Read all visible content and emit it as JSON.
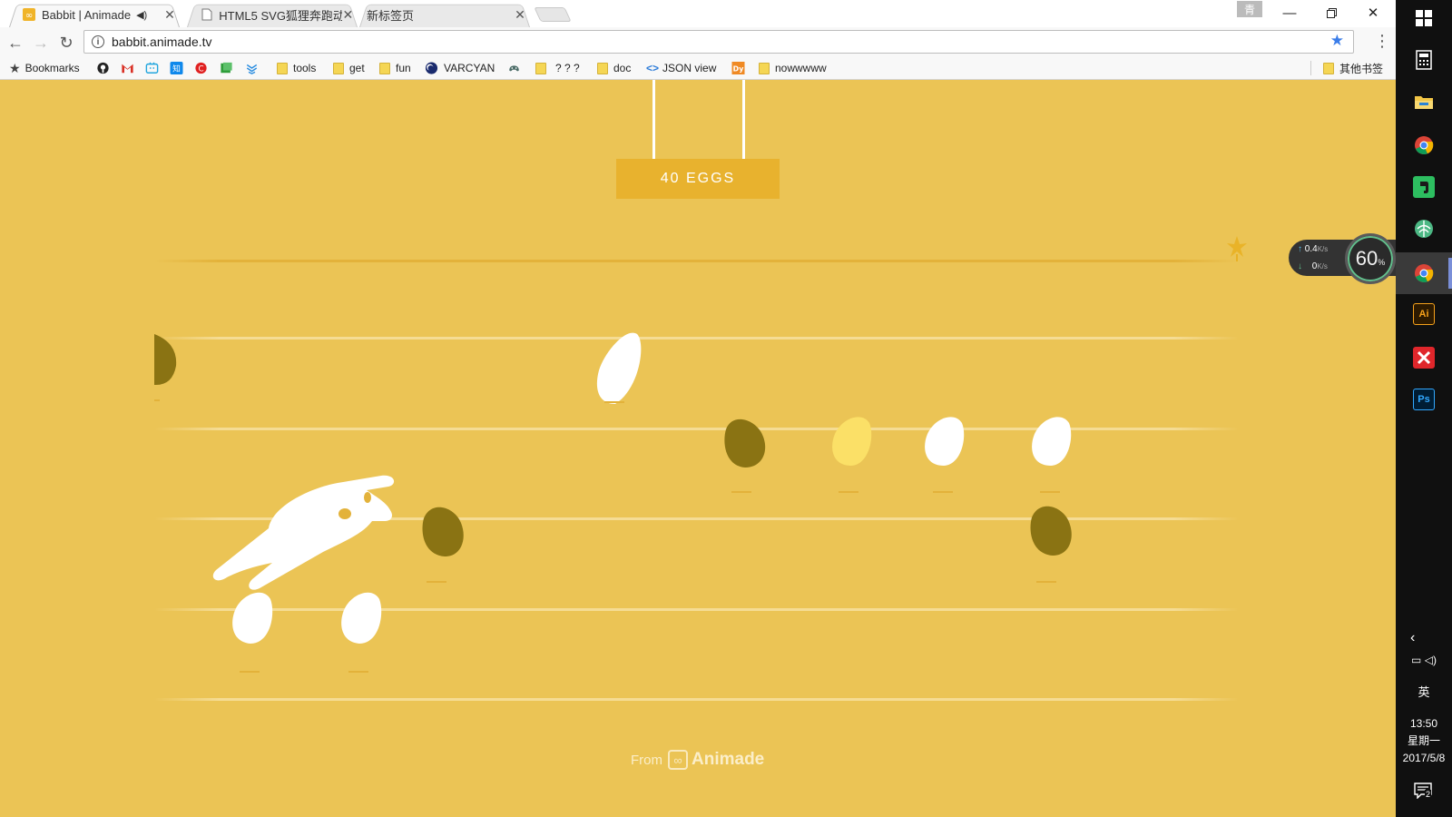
{
  "tabs": [
    {
      "title": "Babbit | Animade",
      "favicon": "animade-icon",
      "active": true
    },
    {
      "title": "HTML5 SVG狐狸奔跑动",
      "favicon": "page-icon",
      "active": false
    },
    {
      "title": "新标签页",
      "favicon": "",
      "active": false
    }
  ],
  "window": {
    "profile_badge": "青"
  },
  "address_bar": {
    "url": "babbit.animade.tv"
  },
  "bookmarks": {
    "items": [
      {
        "label": "Bookmarks",
        "icon": "star-icon"
      },
      {
        "label": "",
        "icon": "github-icon"
      },
      {
        "label": "",
        "icon": "gmail-icon"
      },
      {
        "label": "",
        "icon": "bilibili-icon"
      },
      {
        "label": "",
        "icon": "zhihu-icon"
      },
      {
        "label": "",
        "icon": "red-app-icon"
      },
      {
        "label": "",
        "icon": "green-app-icon"
      },
      {
        "label": "",
        "icon": "blue-app-icon"
      },
      {
        "label": "tools",
        "icon": "folder-icon"
      },
      {
        "label": "get",
        "icon": "folder-icon"
      },
      {
        "label": "fun",
        "icon": "folder-icon"
      },
      {
        "label": "VARCYAN",
        "icon": "varcyan-icon"
      },
      {
        "label": "",
        "icon": "gamepad-icon"
      },
      {
        "label": "? ? ?",
        "icon": "folder-icon"
      },
      {
        "label": "doc",
        "icon": "folder-icon"
      },
      {
        "label": "JSON view",
        "icon": "code-icon"
      },
      {
        "label": "",
        "icon": "dy-icon"
      },
      {
        "label": "nowwwww",
        "icon": "folder-icon"
      }
    ],
    "other": "其他书签"
  },
  "game": {
    "score_label": "40 EGGS",
    "footer_from": "From",
    "footer_brand": "Animade",
    "colors": {
      "background": "#ebc455",
      "board": "#e8b22e",
      "white_egg": "#ffffff",
      "dark_egg": "#8a7313",
      "gold_egg": "#fbe067"
    }
  },
  "net_widget": {
    "upload": "0.4",
    "upload_unit": "K/s",
    "download": "0",
    "download_unit": "K/s",
    "percent": "60",
    "percent_unit": "%"
  },
  "taskbar": {
    "apps": [
      "windows-start-icon",
      "calculator-icon",
      "file-explorer-icon",
      "chrome-icon",
      "evernote-icon",
      "network-app-icon",
      "chrome-icon",
      "illustrator-icon",
      "xmind-icon",
      "photoshop-icon"
    ],
    "ai_label": "Ai",
    "ps_label": "Ps",
    "ime": "英",
    "time": "13:50",
    "weekday": "星期一",
    "date": "2017/5/8",
    "notifications": "2"
  }
}
